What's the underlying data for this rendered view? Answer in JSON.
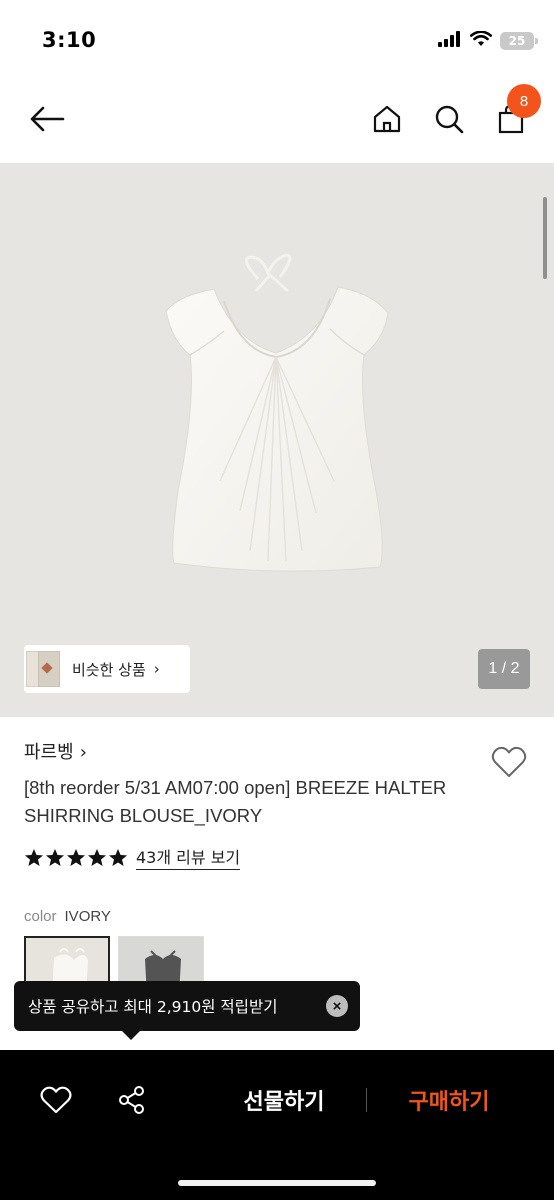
{
  "status_bar": {
    "time": "3:10",
    "battery": "25",
    "icons": [
      "signal-icon",
      "wifi-icon",
      "battery-icon"
    ]
  },
  "nav": {
    "icons": [
      "back-arrow-icon",
      "home-icon",
      "search-icon",
      "shopping-bag-icon"
    ],
    "cart_count": "8"
  },
  "gallery": {
    "similar_label": "비슷한 상품",
    "similar_chevron": "›",
    "page_counter": "1 / 2"
  },
  "product": {
    "brand": "파르벵",
    "brand_chevron": "›",
    "title": "[8th reorder 5/31 AM07:00 open] BREEZE HALTER SHIRRING BLOUSE_IVORY",
    "rating": 5,
    "review_link": "43개 리뷰 보기",
    "color_label": "color",
    "color_value": "IVORY",
    "swatches": [
      "ivory",
      "gray"
    ]
  },
  "tooltip": {
    "text": "상품 공유하고 최대 2,910원 적립받기",
    "close": "×"
  },
  "bottom_bar": {
    "gift_label": "선물하기",
    "buy_label": "구매하기"
  },
  "colors": {
    "accent": "#f2541b",
    "bar": "#000000",
    "hero_bg": "#e6e5e1"
  }
}
